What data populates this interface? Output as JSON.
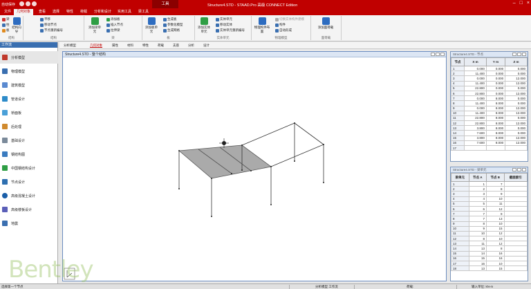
{
  "titlebar": {
    "autosave": "自动保存",
    "context_tab": "工具",
    "title": "Structure4.STD - STAAD.Pro 高级 CONNECT Edition"
  },
  "menu": [
    "文件",
    "几何对象",
    "查看",
    "选择",
    "特性",
    "荷载",
    "分析和设计",
    "实用工具",
    "梁工具"
  ],
  "search": {
    "placeholder": "搜索"
  },
  "ribbon": {
    "g1_buttons": [
      "梁",
      "柱",
      "板"
    ],
    "g2_big": "结构向导",
    "g3_items": [
      "平移",
      "移动节点",
      "节点重新编号"
    ],
    "g4_big": "添加梁单元",
    "g5_items": [
      "添加板",
      "插入节点",
      "拉伸梁"
    ],
    "g6_big": "添加板单元",
    "g7_items": [
      "生成板",
      "参数化模型",
      "生成网格"
    ],
    "g8_big": "添加实体单元",
    "g9_items": [
      "实体单元",
      "移动实体",
      "实体单元重新编号"
    ],
    "g10_big": "物理构件布置",
    "g11_items": [
      "切换实体构件建模",
      "构件",
      "自动形成"
    ],
    "g12_big": "添加面荷载",
    "labels": [
      "结构",
      "梁",
      "板",
      "实体单元",
      "物理模型",
      "面荷载"
    ]
  },
  "viewtabs": [
    "分析模型",
    "几何对象",
    "属性",
    "材料",
    "特性",
    "荷载",
    "支座",
    "分析",
    "设计"
  ],
  "workflow": {
    "header": "工作流",
    "items": [
      "分析模型",
      "物理模型",
      "建筑模型",
      "管道设计",
      "桥面板",
      "后处理",
      "基础设计",
      "钢结构图",
      "中国钢结构设计",
      "节点设计",
      "高级混凝土设计",
      "高级楼板设计",
      "地震"
    ]
  },
  "viewport": {
    "title": "Structure4.STD - 整个结构"
  },
  "watermark": "Bentley",
  "nodes_table": {
    "title": "Structure4.STD - 节点",
    "headers": [
      "节点",
      "X m",
      "Y m",
      "Z m"
    ],
    "rows": [
      [
        "1",
        "0.000",
        "0.000",
        "0.000"
      ],
      [
        "2",
        "11.400",
        "0.000",
        "0.000"
      ],
      [
        "3",
        "0.000",
        "0.000",
        "12.000"
      ],
      [
        "4",
        "11.400",
        "0.000",
        "12.000"
      ],
      [
        "5",
        "22.800",
        "0.000",
        "0.000"
      ],
      [
        "6",
        "22.800",
        "0.000",
        "12.000"
      ],
      [
        "7",
        "0.000",
        "8.000",
        "0.000"
      ],
      [
        "8",
        "11.400",
        "8.000",
        "0.000"
      ],
      [
        "9",
        "0.000",
        "8.000",
        "12.000"
      ],
      [
        "10",
        "11.400",
        "8.000",
        "12.000"
      ],
      [
        "11",
        "22.800",
        "8.000",
        "0.000"
      ],
      [
        "12",
        "22.800",
        "8.000",
        "12.000"
      ],
      [
        "13",
        "3.800",
        "8.000",
        "0.000"
      ],
      [
        "14",
        "7.600",
        "8.000",
        "0.000"
      ],
      [
        "15",
        "3.800",
        "8.000",
        "12.000"
      ],
      [
        "16",
        "7.600",
        "8.000",
        "12.000"
      ],
      [
        "17",
        "",
        "",
        ""
      ]
    ]
  },
  "beams_table": {
    "title": "Structure4.STD - 梁单元",
    "headers": [
      "梁单元",
      "节点 A",
      "节点 B",
      "截面索引"
    ],
    "rows": [
      [
        "1",
        "1",
        "7",
        ""
      ],
      [
        "2",
        "2",
        "8",
        ""
      ],
      [
        "3",
        "3",
        "9",
        ""
      ],
      [
        "4",
        "4",
        "10",
        ""
      ],
      [
        "5",
        "5",
        "11",
        ""
      ],
      [
        "6",
        "6",
        "12",
        ""
      ],
      [
        "7",
        "7",
        "9",
        ""
      ],
      [
        "8",
        "7",
        "13",
        ""
      ],
      [
        "9",
        "8",
        "10",
        ""
      ],
      [
        "10",
        "9",
        "15",
        ""
      ],
      [
        "11",
        "10",
        "12",
        ""
      ],
      [
        "12",
        "8",
        "10",
        ""
      ],
      [
        "13",
        "11",
        "12",
        ""
      ],
      [
        "14",
        "13",
        "8",
        ""
      ],
      [
        "15",
        "14",
        "16",
        ""
      ],
      [
        "16",
        "15",
        "16",
        ""
      ],
      [
        "17",
        "16",
        "10",
        ""
      ],
      [
        "18",
        "13",
        "15",
        ""
      ]
    ]
  },
  "status": {
    "left": "选择第一个节点",
    "mode": "分析模型 工作流",
    "load": "荷载:",
    "units": "输入单位: kN-m"
  },
  "colors": {
    "brand": "#c00000",
    "accent": "#3a6fb0"
  },
  "icons": [
    "save-icon",
    "undo-icon",
    "redo-icon",
    "minimize-icon",
    "maximize-icon",
    "close-icon"
  ]
}
